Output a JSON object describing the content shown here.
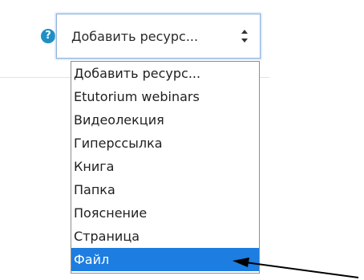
{
  "help_icon": {
    "glyph": "?"
  },
  "select": {
    "value": "Добавить ресурс...",
    "arrows_glyph": "⬍"
  },
  "dropdown": {
    "options": [
      "Добавить ресурс...",
      "Etutorium webinars",
      "Видеолекция",
      "Гиперссылка",
      "Книга",
      "Папка",
      "Пояснение",
      "Страница",
      "Файл"
    ],
    "selected_index": 8
  },
  "colors": {
    "help_icon": "#1f8fc4",
    "focus_border": "#8fb4dd",
    "selected_bg": "#1d7de0",
    "selected_text": "#ffffff"
  }
}
